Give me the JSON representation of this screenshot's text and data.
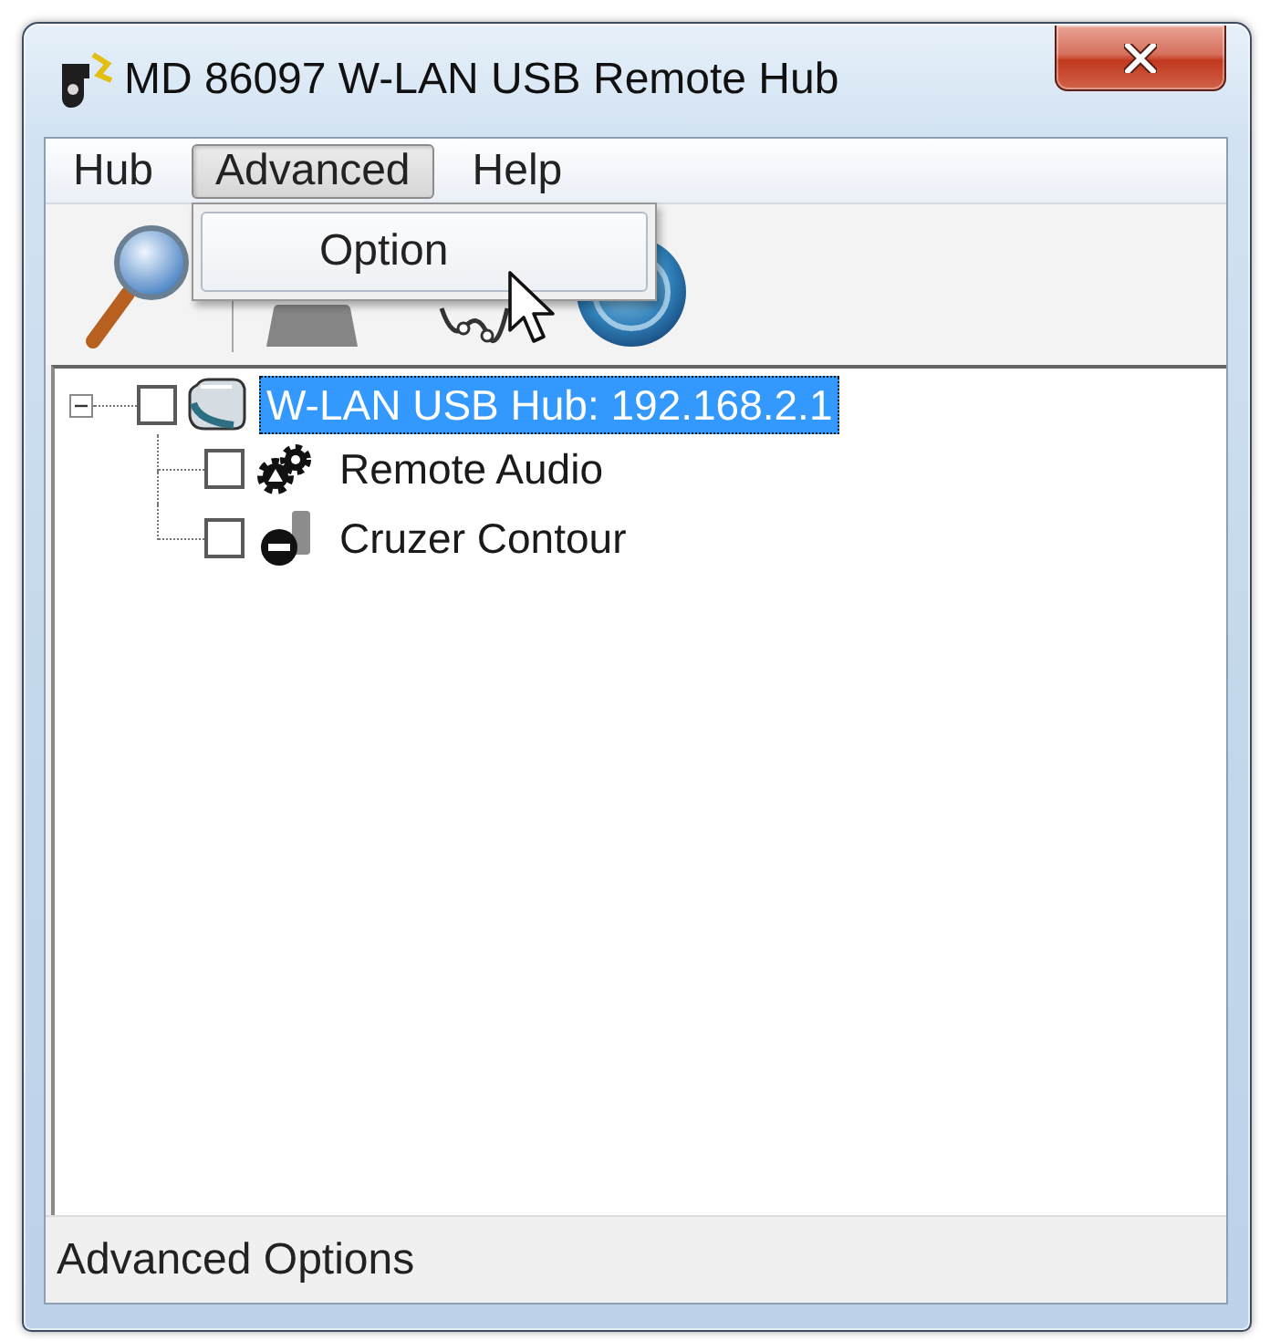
{
  "window": {
    "title": "MD 86097 W-LAN USB Remote Hub"
  },
  "menu_bar": [
    {
      "label": "Hub",
      "selected": false
    },
    {
      "label": "Advanced",
      "selected": true
    },
    {
      "label": "Help",
      "selected": false
    }
  ],
  "dropdown": {
    "items": [
      {
        "label": "Option",
        "selected": true
      }
    ]
  },
  "tree": {
    "items": [
      {
        "kind": "hub",
        "label": "W-LAN USB Hub: 192.168.2.1",
        "checked": false,
        "selected": true,
        "expanded": true,
        "children": [
          {
            "kind": "audio",
            "label": "Remote Audio",
            "checked": false,
            "selected": false
          },
          {
            "kind": "storage",
            "label": "Cruzer Contour",
            "checked": false,
            "selected": false
          }
        ]
      }
    ]
  },
  "status_bar": {
    "text": "Advanced Options"
  }
}
